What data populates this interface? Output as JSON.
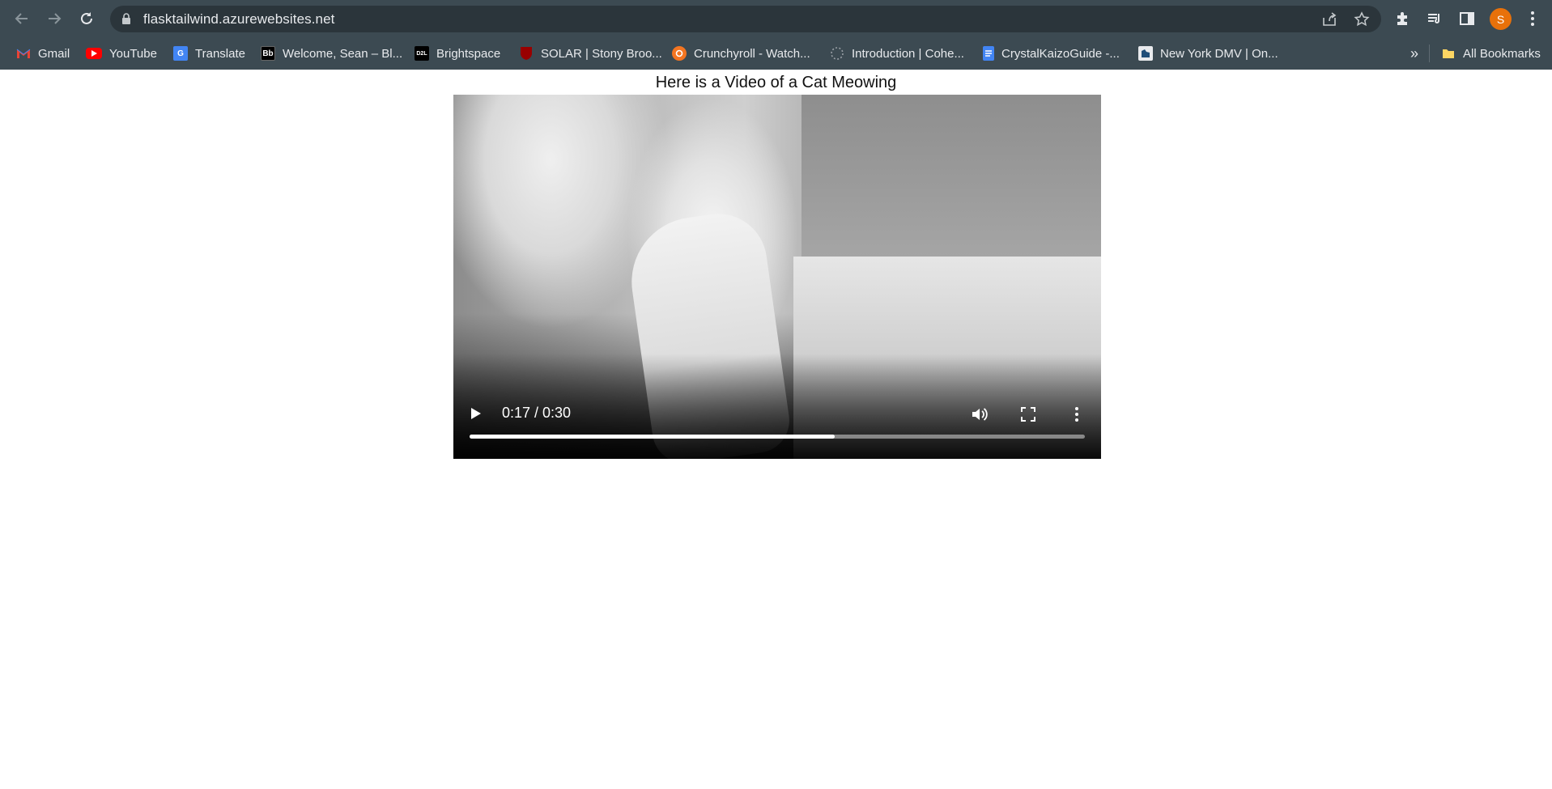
{
  "browser": {
    "url": "flasktailwind.azurewebsites.net",
    "profile_initial": "S",
    "bookmarks": [
      {
        "label": "Gmail",
        "icon": "gmail-icon"
      },
      {
        "label": "YouTube",
        "icon": "youtube-icon"
      },
      {
        "label": "Translate",
        "icon": "translate-icon"
      },
      {
        "label": "Welcome, Sean – Bl...",
        "icon": "blackboard-icon"
      },
      {
        "label": "Brightspace",
        "icon": "d2l-icon"
      },
      {
        "label": "SOLAR | Stony Broo...",
        "icon": "stony-brook-icon"
      },
      {
        "label": "Crunchyroll - Watch...",
        "icon": "crunchyroll-icon"
      },
      {
        "label": "Introduction | Cohe...",
        "icon": "cohere-icon"
      },
      {
        "label": "CrystalKaizoGuide -...",
        "icon": "google-docs-icon"
      },
      {
        "label": "New York DMV | On...",
        "icon": "ny-dmv-icon"
      }
    ],
    "overflow_label": "»",
    "all_bookmarks_label": "All Bookmarks"
  },
  "page": {
    "title": "Here is a Video of a Cat Meowing"
  },
  "video": {
    "time_display": "0:17 / 0:30",
    "progress_fraction": 0.593
  },
  "colors": {
    "chrome_bg": "#3c4a52",
    "omnibox_bg": "#2b353b",
    "avatar": "#e8710a"
  }
}
